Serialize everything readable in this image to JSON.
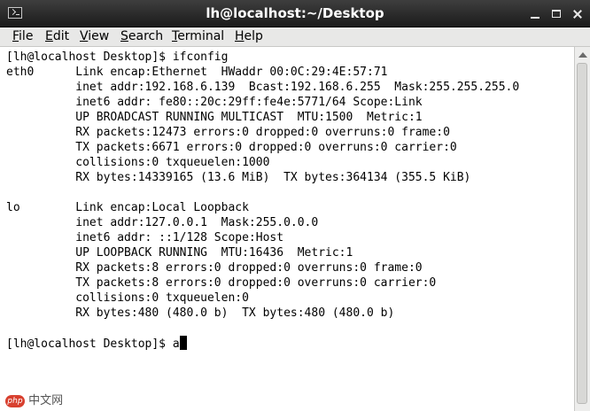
{
  "window": {
    "title": "lh@localhost:~/Desktop"
  },
  "menubar": {
    "items": [
      {
        "label": "File"
      },
      {
        "label": "Edit"
      },
      {
        "label": "View"
      },
      {
        "label": "Search"
      },
      {
        "label": "Terminal"
      },
      {
        "label": "Help"
      }
    ]
  },
  "terminal": {
    "output": "[lh@localhost Desktop]$ ifconfig\neth0      Link encap:Ethernet  HWaddr 00:0C:29:4E:57:71  \n          inet addr:192.168.6.139  Bcast:192.168.6.255  Mask:255.255.255.0\n          inet6 addr: fe80::20c:29ff:fe4e:5771/64 Scope:Link\n          UP BROADCAST RUNNING MULTICAST  MTU:1500  Metric:1\n          RX packets:12473 errors:0 dropped:0 overruns:0 frame:0\n          TX packets:6671 errors:0 dropped:0 overruns:0 carrier:0\n          collisions:0 txqueuelen:1000 \n          RX bytes:14339165 (13.6 MiB)  TX bytes:364134 (355.5 KiB)\n\nlo        Link encap:Local Loopback  \n          inet addr:127.0.0.1  Mask:255.0.0.0\n          inet6 addr: ::1/128 Scope:Host\n          UP LOOPBACK RUNNING  MTU:16436  Metric:1\n          RX packets:8 errors:0 dropped:0 overruns:0 frame:0\n          TX packets:8 errors:0 dropped:0 overruns:0 carrier:0\n          collisions:0 txqueuelen:0 \n          RX bytes:480 (480.0 b)  TX bytes:480 (480.0 b)\n\n",
    "prompt": "[lh@localhost Desktop]$ ",
    "input": "a"
  },
  "watermark": {
    "logo": "php",
    "text": "中文网"
  },
  "colors": {
    "titlebar": "#2b2b2b",
    "menubar": "#e8e8e7",
    "terminal_bg": "#ffffff",
    "terminal_fg": "#000000"
  }
}
